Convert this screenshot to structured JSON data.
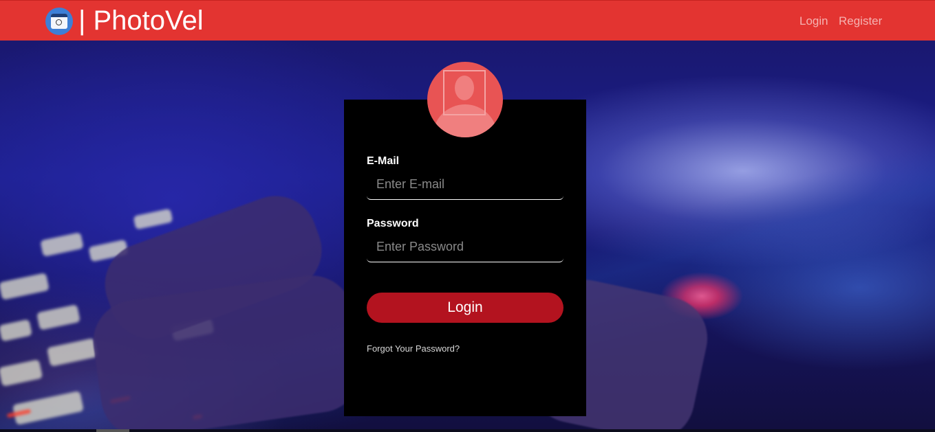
{
  "navbar": {
    "brand_title": "| PhotoVel",
    "logo_icon": "photo-window-icon",
    "background_color": "#e33431",
    "links": {
      "login": "Login",
      "register": "Register"
    }
  },
  "login_form": {
    "avatar_icon": "user-silhouette-icon",
    "email": {
      "label": "E-Mail",
      "placeholder": "Enter E-mail",
      "value": ""
    },
    "password": {
      "label": "Password",
      "placeholder": "Enter Password",
      "value": ""
    },
    "submit_label": "Login",
    "forgot_password_link": "Forgot Your Password?",
    "button_color": "#b3131f",
    "card_color": "#000000"
  }
}
